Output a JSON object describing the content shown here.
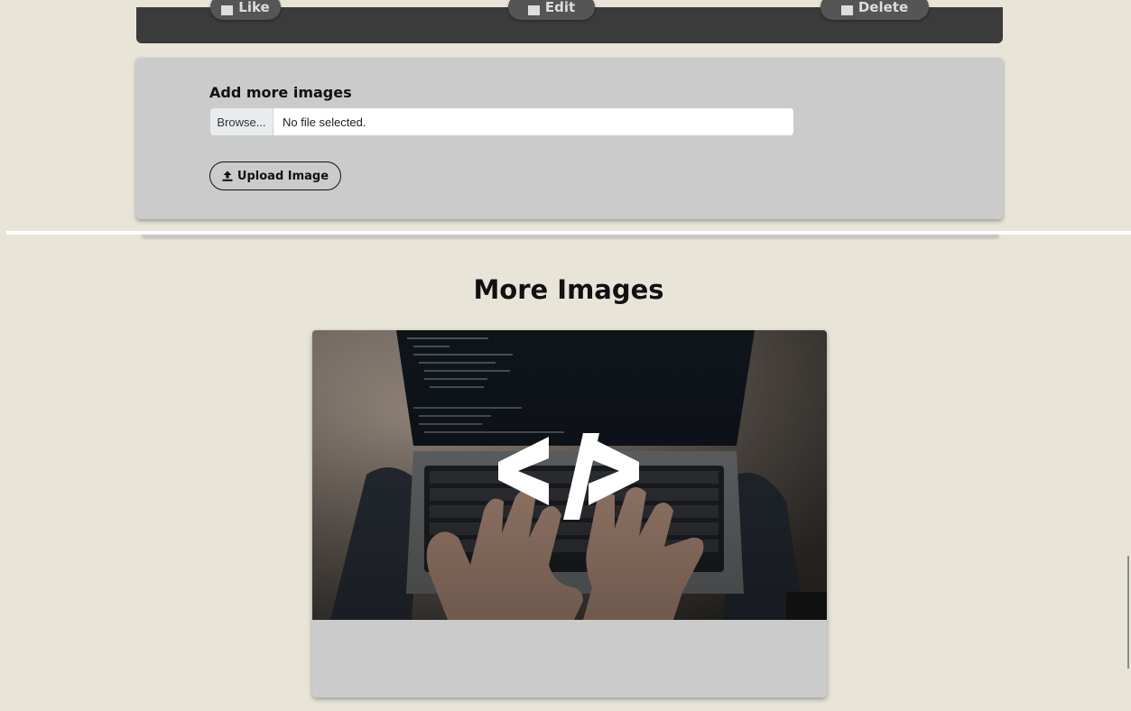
{
  "actions": {
    "like_label": "Like",
    "edit_label": "Edit",
    "delete_label": "Delete"
  },
  "upload": {
    "title": "Add more images",
    "browse_label": "Browse...",
    "file_status": "No file selected.",
    "button_label": "Upload Image"
  },
  "gallery": {
    "title": "More Images",
    "image_code_symbol": "</>"
  },
  "colors": {
    "background": "#e8e5d8",
    "card": "#cbcbcb",
    "dark_card": "#3b3b3b"
  }
}
